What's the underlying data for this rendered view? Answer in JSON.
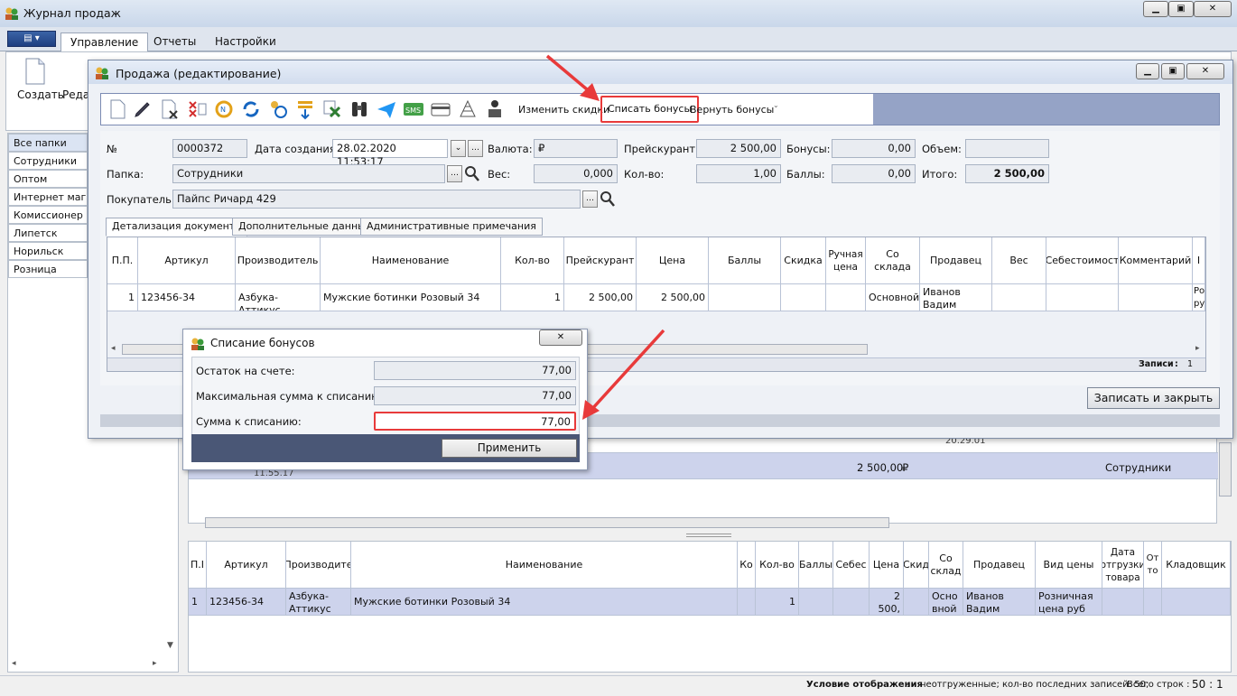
{
  "main_window": {
    "title": "Журнал продаж",
    "ribbon_tabs": [
      "Управление",
      "Отчеты",
      "Настройки"
    ],
    "ribbon_buttons": [
      "Создать",
      "Реда"
    ]
  },
  "folders": {
    "items": [
      "Все папки",
      "Сотрудники",
      "Оптом",
      "Интернет магази",
      "Комиссионер",
      "Липетск",
      "Норильск",
      "Розница"
    ],
    "selected": "Все папки"
  },
  "background_list": {
    "partial_time_1": "20.29.01",
    "partial_time_2": "11.55.17",
    "row_sum": "2 500,00",
    "row_currency": "₽",
    "row_folder": "Сотрудники"
  },
  "detail_grid": {
    "columns": [
      "П.І",
      "Артикул",
      "Производите",
      "Наименование",
      "Ко",
      "Кол-во",
      "Баллы",
      "Себес",
      "Цена",
      "Скид",
      "Со склад",
      "Продавец",
      "Вид цены",
      "Дата отгрузки товара",
      "От то",
      "Кладовщик"
    ],
    "row": {
      "pp": "1",
      "article": "123456-34",
      "maker": "Азбука-Аттикус",
      "name": "Мужские ботинки Розовый 34",
      "qty": "1",
      "price": "2 500, 00",
      "warehouse": "Осно вной",
      "seller": "Иванов Вадим",
      "price_type": "Розничная цена руб"
    }
  },
  "sale_dialog": {
    "title": "Продажа (редактирование)",
    "toolbar_text_buttons": [
      "Изменить скидки",
      "Списать бонусы",
      "Вернуть бонусы"
    ],
    "toolbar_icons": [
      "new-doc-icon",
      "edit-icon",
      "delete-icon",
      "cancel-icon",
      "renumber-icon",
      "refresh-icon",
      "customer-history-icon",
      "sort-icon",
      "excel-icon",
      "binoculars-icon",
      "send-icon",
      "sms-icon",
      "card-icon",
      "pyramid-icon",
      "cashier-icon"
    ],
    "fields": {
      "number_label": "№",
      "number": "0000372",
      "created_label": "Дата создания:",
      "created": "28.02.2020 11:53:17",
      "currency_label": "Валюта:",
      "currency": "₽",
      "pricelist_label": "Прейскурант:",
      "pricelist": "2 500,00",
      "bonuses_label": "Бонусы:",
      "bonuses": "0,00",
      "volume_label": "Объем:",
      "volume": "",
      "folder_label": "Папка:",
      "folder": "Сотрудники",
      "weight_label": "Вес:",
      "weight": "0,000",
      "qty_label": "Кол-во:",
      "qty": "1,00",
      "points_label": "Баллы:",
      "points": "0,00",
      "total_label": "Итого:",
      "total": "2 500,00",
      "buyer_label": "Покупатель:",
      "buyer": "Пайпс Ричард 429"
    },
    "tabs": [
      "Детализация документа",
      "Дополнительные данные",
      "Административные примечания"
    ],
    "grid": {
      "columns": [
        "П.П.",
        "Артикул",
        "Производитель",
        "Наименование",
        "Кол-во",
        "Прейскурант",
        "Цена",
        "Баллы",
        "Скидка",
        "Ручная цена",
        "Со склада",
        "Продавец",
        "Вес",
        "Себестоимост",
        "Комментарий",
        "I"
      ],
      "row": {
        "pp": "1",
        "article": "123456-34",
        "maker": "Азбука-Аттикус",
        "name": "Мужские ботинки Розовый 34",
        "qty": "1",
        "pricelist": "2 500,00",
        "price": "2 500,00",
        "warehouse": "Основной",
        "seller": "Иванов Вадим",
        "last": "Розн руб"
      },
      "records_label": "Записи",
      "records_count": "1"
    },
    "save_close": "Записать и закрыть"
  },
  "bonus_dialog": {
    "title": "Списание бонусов",
    "rows": [
      {
        "label": "Остаток на счете:",
        "value": "77,00"
      },
      {
        "label": "Максимальная сумма к списанию:",
        "value": "77,00"
      },
      {
        "label": "Сумма к списанию:",
        "value": "77,00"
      }
    ],
    "apply": "Применить"
  },
  "status_bar": {
    "condition_label": "Условие отображения",
    "condition_value": "неотгруженные; кол-во последних записей: 50;",
    "total_rows_label": "Всего строк :",
    "total_rows_value": "50 : 1"
  },
  "colors": {
    "accent_red": "#e83a3a",
    "toolbar": "#95a3c6",
    "selected_row": "#cdd3ec"
  }
}
